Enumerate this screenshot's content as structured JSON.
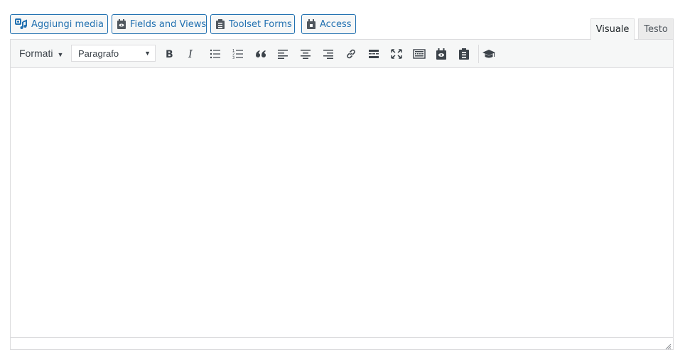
{
  "media_buttons": {
    "add_media": "Aggiungi media",
    "fields_and_views": "Fields and Views",
    "toolset_forms": "Toolset Forms",
    "access": "Access"
  },
  "tabs": {
    "visual": "Visuale",
    "text": "Testo"
  },
  "toolbar": {
    "formats_label": "Formati",
    "block_format_value": "Paragrafo",
    "buttons": [
      "bold-icon",
      "italic-icon",
      "bullet-list-icon",
      "numbered-list-icon",
      "blockquote-icon",
      "align-left-icon",
      "align-center-icon",
      "align-right-icon",
      "link-icon",
      "read-more-icon",
      "fullscreen-icon",
      "toolbar-toggle-icon",
      "fields-views-icon",
      "toolset-forms-icon",
      "learn-icon"
    ]
  },
  "colors": {
    "accent": "#2271b1",
    "toolbar_bg": "#f6f7f7",
    "border": "#dcdcde",
    "icon": "#3c434a"
  }
}
